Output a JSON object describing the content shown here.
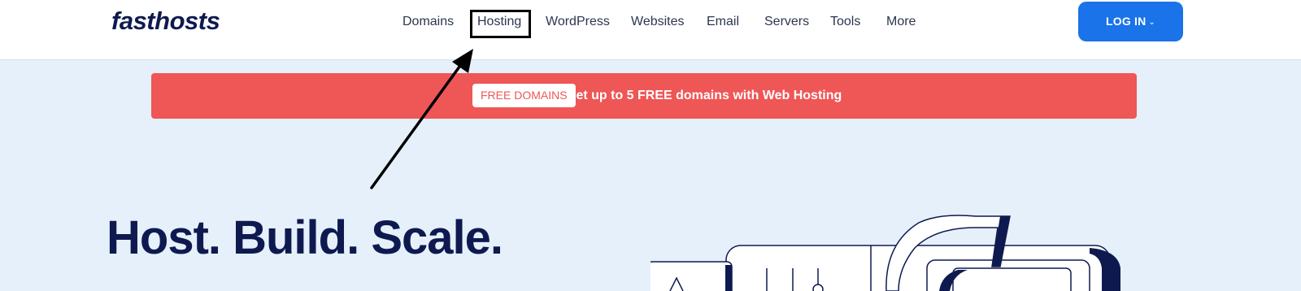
{
  "header": {
    "logo": "fasthosts",
    "nav": [
      {
        "label": "Domains",
        "name": "nav-domains"
      },
      {
        "label": "Hosting",
        "name": "nav-hosting"
      },
      {
        "label": "WordPress",
        "name": "nav-wordpress"
      },
      {
        "label": "Websites",
        "name": "nav-websites"
      },
      {
        "label": "Email",
        "name": "nav-email"
      },
      {
        "label": "Servers",
        "name": "nav-servers"
      },
      {
        "label": "Tools",
        "name": "nav-tools"
      },
      {
        "label": "More",
        "name": "nav-more"
      }
    ],
    "login_label": "LOG IN",
    "login_icon": "chevron-down-icon"
  },
  "banner": {
    "badge": "FREE DOMAINS",
    "text": "Get up to 5 FREE domains with Web Hosting"
  },
  "hero": {
    "title": "Host. Build. Scale."
  },
  "colors": {
    "brand_navy": "#0e1a4f",
    "accent_blue": "#1a73e8",
    "banner_red": "#ef5656",
    "page_bg": "#e6f0fa"
  }
}
